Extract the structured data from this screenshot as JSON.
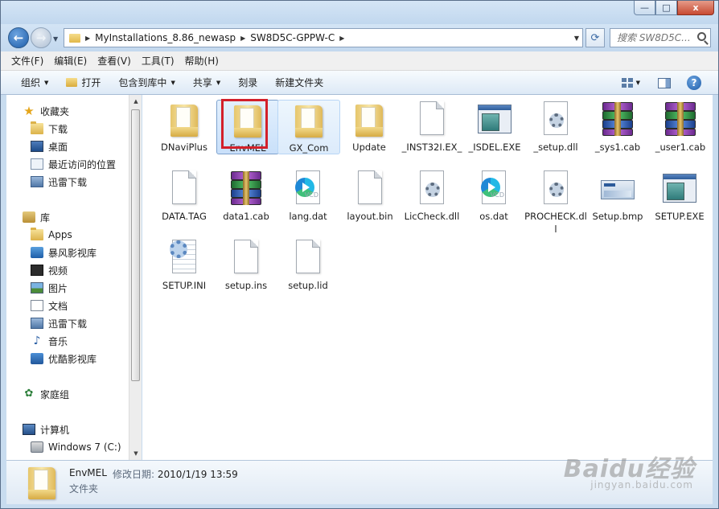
{
  "window": {
    "minimize": "—",
    "maximize": "□",
    "close": "x"
  },
  "address": {
    "crumbs": [
      "MyInstallations_8.86_newasp",
      "SW8D5C-GPPW-C"
    ],
    "search_placeholder": "搜索 SW8D5C..."
  },
  "menu": [
    "文件(F)",
    "编辑(E)",
    "查看(V)",
    "工具(T)",
    "帮助(H)"
  ],
  "commands": {
    "organize": "组织",
    "open": "打开",
    "include": "包含到库中",
    "share": "共享",
    "burn": "刻录",
    "new_folder": "新建文件夹"
  },
  "sidebar": {
    "favorites": {
      "label": "收藏夹",
      "items": [
        "下载",
        "桌面",
        "最近访问的位置",
        "迅雷下载"
      ]
    },
    "libraries": {
      "label": "库",
      "items": [
        "Apps",
        "暴风影视库",
        "视频",
        "图片",
        "文档",
        "迅雷下载",
        "音乐",
        "优酷影视库"
      ]
    },
    "homegroup": "家庭组",
    "computer": {
      "label": "计算机",
      "items": [
        "Windows 7 (C:)"
      ]
    }
  },
  "files": [
    {
      "name": "DNaviPlus",
      "icon": "folder-icon"
    },
    {
      "name": "EnvMEL",
      "icon": "folder-icon"
    },
    {
      "name": "GX_Com",
      "icon": "folder-icon"
    },
    {
      "name": "Update",
      "icon": "folder-icon"
    },
    {
      "name": "_INST32I.EX_",
      "icon": "document-icon"
    },
    {
      "name": "_ISDEL.EXE",
      "icon": "exe-icon"
    },
    {
      "name": "_setup.dll",
      "icon": "dll-gear-icon"
    },
    {
      "name": "_sys1.cab",
      "icon": "winrar-archive-icon"
    },
    {
      "name": "_user1.cab",
      "icon": "winrar-archive-icon"
    },
    {
      "name": "DATA.TAG",
      "icon": "document-icon"
    },
    {
      "name": "data1.cab",
      "icon": "winrar-archive-icon"
    },
    {
      "name": "lang.dat",
      "icon": "vcd-player-icon"
    },
    {
      "name": "layout.bin",
      "icon": "document-icon"
    },
    {
      "name": "LicCheck.dll",
      "icon": "dll-gear-icon"
    },
    {
      "name": "os.dat",
      "icon": "vcd-player-icon"
    },
    {
      "name": "PROCHECK.dll",
      "icon": "dll-gear-icon"
    },
    {
      "name": "Setup.bmp",
      "icon": "bitmap-icon"
    },
    {
      "name": "SETUP.EXE",
      "icon": "exe-icon"
    },
    {
      "name": "SETUP.INI",
      "icon": "ini-config-icon"
    },
    {
      "name": "setup.ins",
      "icon": "document-icon"
    },
    {
      "name": "setup.lid",
      "icon": "document-icon"
    }
  ],
  "details": {
    "name": "EnvMEL",
    "modified_label": "修改日期:",
    "modified_value": "2010/1/19 13:59",
    "type": "文件夹"
  },
  "watermark": {
    "main": "Baidu经验",
    "sub": "jingyan.baidu.com"
  }
}
